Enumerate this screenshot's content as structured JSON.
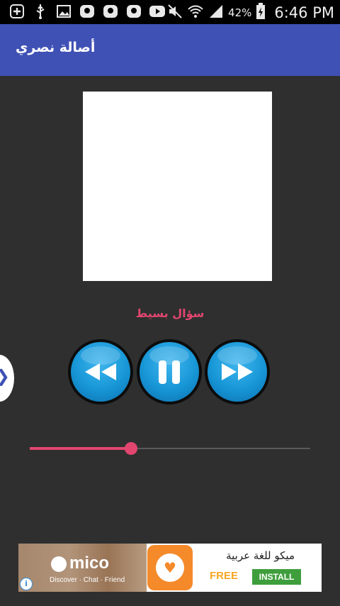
{
  "status_bar": {
    "left_icons": [
      "add-icon",
      "usb-icon",
      "image-icon",
      "app-icon",
      "app-icon",
      "app-icon",
      "youtube-icon"
    ],
    "right_icons": [
      "mute-icon",
      "wifi-icon",
      "signal-icon",
      "battery-charging-icon"
    ],
    "battery": "42%",
    "time": "6:46 PM"
  },
  "app_bar": {
    "title": "أصالة نصري",
    "color": "#3f51b5"
  },
  "player": {
    "song_title": "سؤال بسيط",
    "accent_color": "#e2466f",
    "progress": 0.36,
    "controls": [
      "rewind-icon",
      "pause-icon",
      "fast-forward-icon"
    ]
  },
  "side_handle": {
    "glyph": "❯"
  },
  "ad": {
    "brand": "mico",
    "tagline": "Discover · Chat · Friend",
    "app_name": "ميكو للغة عربية",
    "free_label": "FREE",
    "install_label": "INSTALL",
    "info_glyph": "i"
  }
}
